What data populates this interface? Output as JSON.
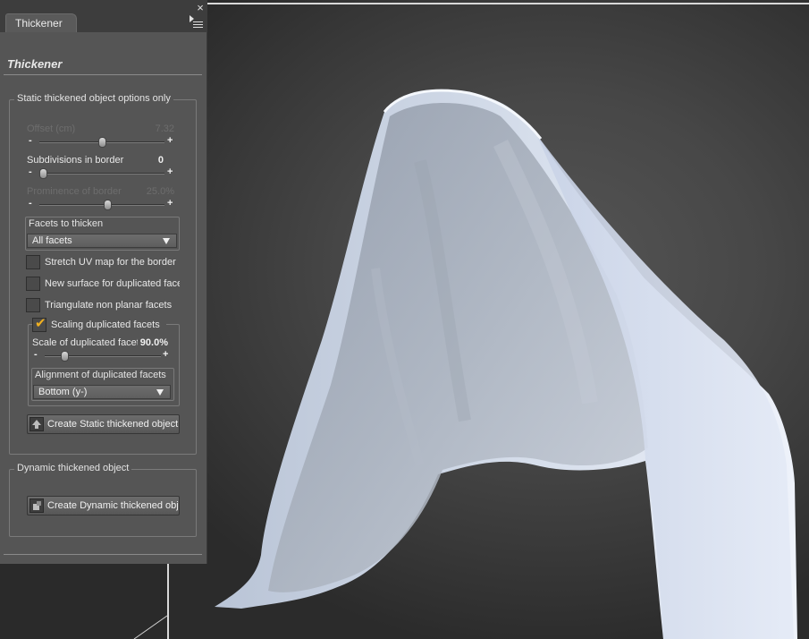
{
  "panel": {
    "tab_label": "Thickener",
    "title": "Thickener",
    "close_glyph": "×"
  },
  "static_group": {
    "label": "Static thickened object options only",
    "offset": {
      "label": "Offset (cm)",
      "value": "7.32",
      "enabled": false,
      "fraction": 0.5
    },
    "subdivisions": {
      "label": "Subdivisions in border",
      "value": "0",
      "enabled": true,
      "fraction": 0.0
    },
    "prominence": {
      "label": "Prominence of border",
      "value": "25.0%",
      "enabled": false,
      "fraction": 0.55
    },
    "facets_group": {
      "label": "Facets to thicken",
      "selected": "All facets"
    },
    "checkboxes": [
      {
        "label": "Stretch UV map for the border",
        "checked": false
      },
      {
        "label": "New surface for duplicated facets",
        "checked": false
      },
      {
        "label": "Triangulate non planar facets",
        "checked": false
      }
    ],
    "scaling_group": {
      "label": "Scaling duplicated facets",
      "checked": true,
      "scale": {
        "label": "Scale of duplicated facets",
        "value": "90.0%",
        "fraction": 0.15
      },
      "alignment_group": {
        "label": "Alignment of duplicated facets",
        "selected": "Bottom (y-)"
      }
    },
    "create_button": "Create Static thickened object"
  },
  "dynamic_group": {
    "label": "Dynamic thickened object",
    "create_button": "Create Dynamic thickened object"
  },
  "slider": {
    "minus": "-",
    "plus": "+"
  },
  "colors": {
    "panel_bg": "#555555",
    "viewport_bg": "#474747",
    "cloth": "#dfe5f0",
    "accent_check": "#f0b020"
  },
  "icons": {
    "close": "close-icon",
    "menu": "panel-menu-icon",
    "static_button": "shape-up-icon",
    "dynamic_button": "dynamic-object-icon",
    "check": "checkmark-icon"
  }
}
